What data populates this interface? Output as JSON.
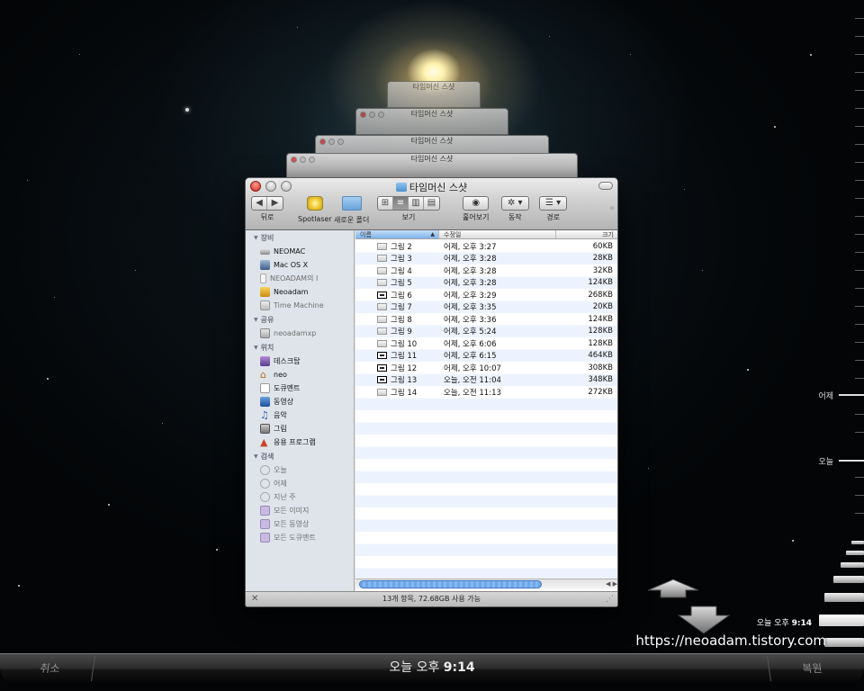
{
  "window": {
    "title": "타임머신 스샷",
    "toolbar": {
      "back_label": "뒤로",
      "spotlaser_label": "Spotlaser",
      "new_folder_label": "새로운 폴더",
      "view_label": "보기",
      "quicklook_label": "훑어보기",
      "action_label": "동작",
      "path_label": "경로"
    }
  },
  "stacked_titles": [
    "타임머신 스샷",
    "타임머신 스샷",
    "타임머신 스샷",
    "타임머신 스샷"
  ],
  "sidebar": {
    "devices_header": "장비",
    "devices": [
      "NEOMAC",
      "Mac OS X",
      "NEOADAM의 I",
      "Neoadam",
      "Time Machine"
    ],
    "shared_header": "공유",
    "shared": [
      "neoadamxp"
    ],
    "places_header": "위치",
    "places": [
      "데스크탑",
      "neo",
      "도큐멘트",
      "동영상",
      "음악",
      "그림",
      "응용 프로그램"
    ],
    "search_header": "검색",
    "search": [
      "오늘",
      "어제",
      "지난 주",
      "모든 이미지",
      "모든 동영상",
      "모든 도큐멘트"
    ]
  },
  "columns": {
    "name": "이름",
    "date": "수정일",
    "size": "크기"
  },
  "files": [
    {
      "name": "그림 2",
      "date": "어제, 오후 3:27",
      "size": "60KB"
    },
    {
      "name": "그림 3",
      "date": "어제, 오후 3:28",
      "size": "28KB"
    },
    {
      "name": "그림 4",
      "date": "어제, 오후 3:28",
      "size": "32KB"
    },
    {
      "name": "그림 5",
      "date": "어제, 오후 3:28",
      "size": "124KB"
    },
    {
      "name": "그림 6",
      "date": "어제, 오후 3:29",
      "size": "268KB"
    },
    {
      "name": "그림 7",
      "date": "어제, 오후 3:35",
      "size": "20KB"
    },
    {
      "name": "그림 8",
      "date": "어제, 오후 3:36",
      "size": "124KB"
    },
    {
      "name": "그림 9",
      "date": "어제, 오후 5:24",
      "size": "128KB"
    },
    {
      "name": "그림 10",
      "date": "어제, 오후 6:06",
      "size": "128KB"
    },
    {
      "name": "그림 11",
      "date": "어제, 오후 6:15",
      "size": "464KB"
    },
    {
      "name": "그림 12",
      "date": "어제, 오후 10:07",
      "size": "308KB"
    },
    {
      "name": "그림 13",
      "date": "오늘, 오전 11:04",
      "size": "348KB"
    },
    {
      "name": "그림 14",
      "date": "오늘, 오전 11:13",
      "size": "272KB"
    }
  ],
  "status": "13개 항목, 72.68GB 사용 가능",
  "timeline": {
    "yesterday_label": "어제",
    "today_label": "오늘",
    "now_prefix": "오늘 오후",
    "now_time": "9:14"
  },
  "bottom": {
    "cancel_label": "취소",
    "restore_label": "복원",
    "time_prefix": "오늘 오후",
    "time_value": "9:14"
  },
  "watermark": "https://neoadam.tistory.com"
}
